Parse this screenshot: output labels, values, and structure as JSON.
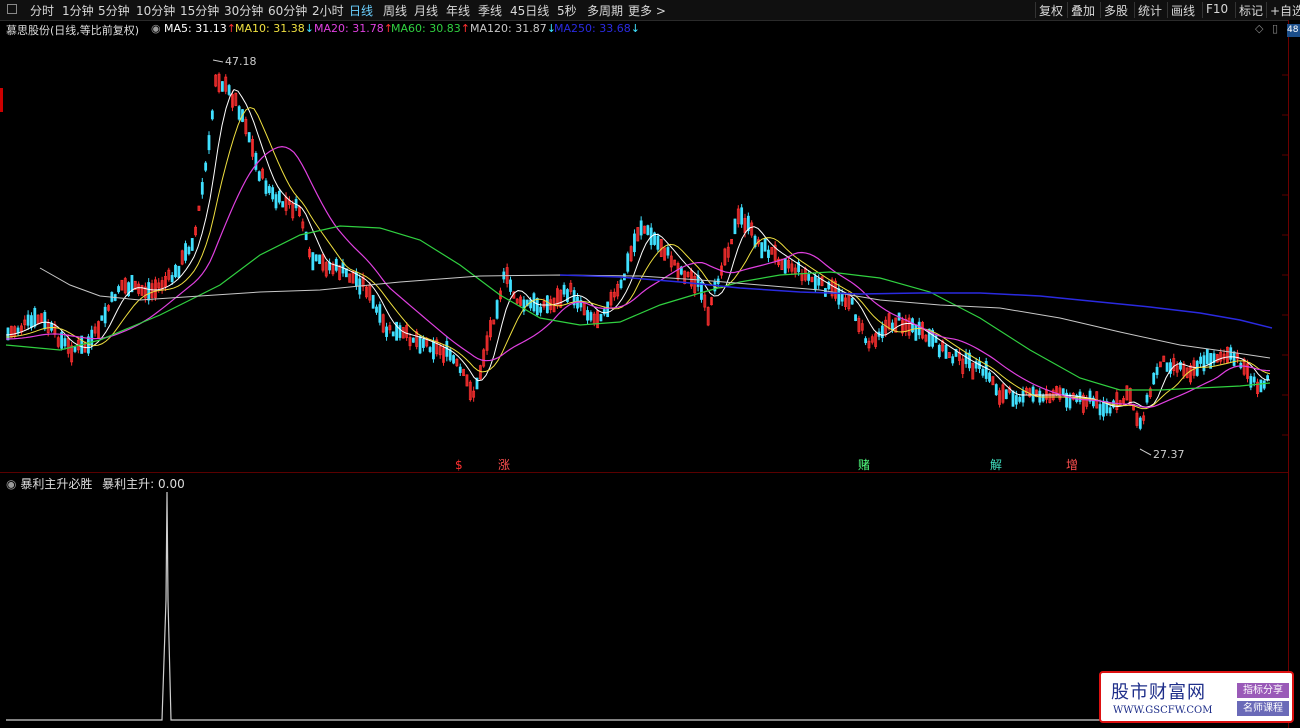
{
  "toolbar": {
    "periods": [
      {
        "label": "分时"
      },
      {
        "label": "1分钟"
      },
      {
        "label": "5分钟"
      },
      {
        "label": "10分钟"
      },
      {
        "label": "15分钟"
      },
      {
        "label": "30分钟"
      },
      {
        "label": "60分钟"
      },
      {
        "label": "2小时"
      },
      {
        "label": "日线",
        "active": true
      },
      {
        "label": "周线"
      },
      {
        "label": "月线"
      },
      {
        "label": "年线"
      },
      {
        "label": "季线"
      },
      {
        "label": "45日线"
      },
      {
        "label": "5秒"
      },
      {
        "label": "多周期"
      },
      {
        "label": "更多 >"
      }
    ],
    "right_buttons": [
      {
        "label": "复权"
      },
      {
        "label": "叠加"
      },
      {
        "label": "多股"
      },
      {
        "label": "统计"
      },
      {
        "label": "画线"
      },
      {
        "label": "F10"
      },
      {
        "label": "标记"
      },
      {
        "label": "+自选"
      }
    ]
  },
  "main_chart": {
    "title": "慕思股份(日线,等比前复权)",
    "indicators": [
      {
        "label": "MA5: 31.13",
        "arrow": "↑",
        "color": "#ffffff",
        "arrow_color": "#ff3030"
      },
      {
        "label": "MA10: 31.38",
        "arrow": "↓",
        "color": "#f0e040",
        "arrow_color": "#40e0ff"
      },
      {
        "label": "MA20: 31.78",
        "arrow": "↑",
        "color": "#e040e0",
        "arrow_color": "#ff3030"
      },
      {
        "label": "MA60: 30.83",
        "arrow": "↑",
        "color": "#30d040",
        "arrow_color": "#ff3030"
      },
      {
        "label": "MA120: 31.87",
        "arrow": "↓",
        "color": "#c8c8c8",
        "arrow_color": "#40e0ff"
      },
      {
        "label": "MA250: 33.68",
        "arrow": "↓",
        "color": "#2a2ae0",
        "arrow_color": "#40e0ff"
      }
    ],
    "right_axis_label": "48",
    "high_label": "47.18",
    "low_label": "27.37",
    "markers": [
      {
        "text": "$",
        "color": "#ff3030"
      },
      {
        "text": "涨",
        "color": "#ff5050"
      },
      {
        "text": "赌",
        "color": "#50ff80"
      },
      {
        "text": "解",
        "color": "#40e0c0"
      },
      {
        "text": "增",
        "color": "#ff5050"
      }
    ],
    "colors": {
      "up": "#ff3030",
      "down": "#40e0ff"
    }
  },
  "sub_chart": {
    "name": "暴利主升必胜",
    "value_label": "暴利主升: 0.00"
  },
  "watermark": {
    "title": "股市财富网",
    "url": "WWW.GSCFW.COM",
    "badge1": "指标分享",
    "badge2": "名师课程"
  }
}
